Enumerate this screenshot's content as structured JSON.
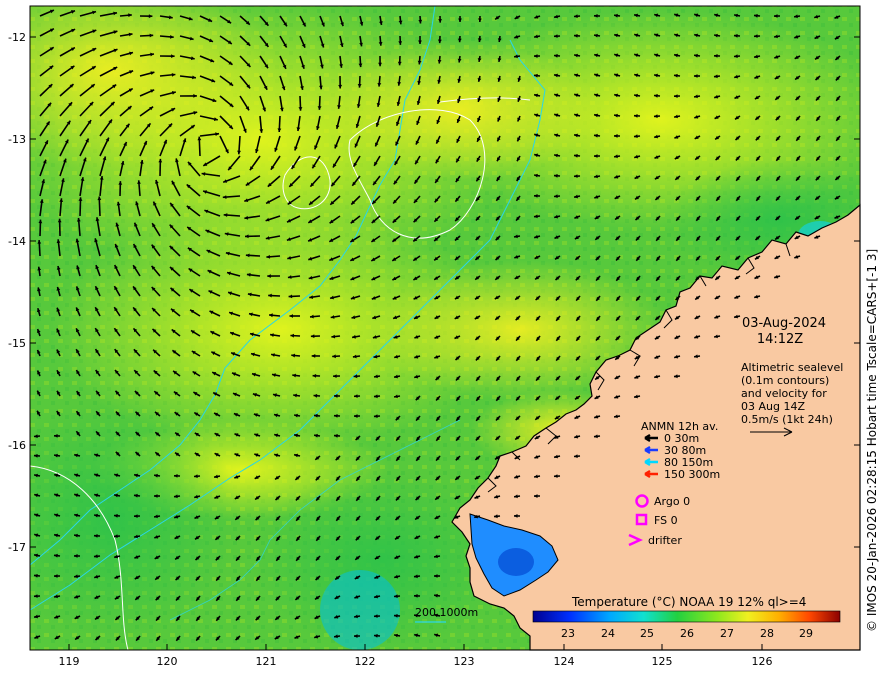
{
  "map": {
    "lon_ticks": [
      "119",
      "120",
      "121",
      "122",
      "123",
      "124",
      "125",
      "126"
    ],
    "lat_ticks": [
      "-12",
      "-13",
      "-14",
      "-15",
      "-16",
      "-17"
    ],
    "date": "03-Aug-2024",
    "time": "14:12Z",
    "info_lines": [
      "Altimetric sealevel",
      "(0.1m contours)",
      "and velocity for",
      "03 Aug 14Z",
      "0.5m/s (1kt 24h)"
    ],
    "legend_title": "ANMN 12h av.",
    "depth_legend": [
      {
        "label": "0 30m",
        "color": "#000000"
      },
      {
        "label": "30 80m",
        "color": "#1a3cff"
      },
      {
        "label": "80 150m",
        "color": "#00d8ff"
      },
      {
        "label": "150 300m",
        "color": "#ff2000"
      }
    ],
    "argo_label": "Argo 0",
    "fs_label": "FS 0",
    "drifter_label": "drifter",
    "marker_color": "#ff00ff",
    "contour_label": "200  1000m",
    "colorbar_title": "Temperature (°C) NOAA 19 12% ql>=4",
    "colorbar_ticks": [
      "23",
      "24",
      "25",
      "26",
      "27",
      "28",
      "29"
    ],
    "side_credit": "© IMOS 20-Jan-2026 02:28:15 Hobart time Tscale=CARS+[-1 3]",
    "colors": {
      "land": "#f9c9a2",
      "sea_green": "#5ecf3c",
      "sea_yellow": "#cdf22a",
      "coast": "#000000",
      "isobath": "#2ad6e8"
    }
  }
}
